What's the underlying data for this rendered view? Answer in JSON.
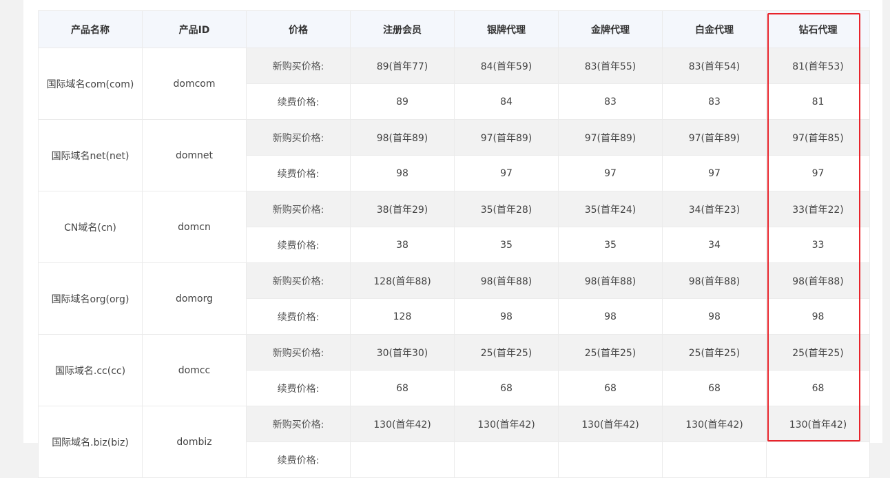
{
  "table": {
    "headers": [
      "产品名称",
      "产品ID",
      "价格",
      "注册会员",
      "银牌代理",
      "金牌代理",
      "白金代理",
      "钻石代理"
    ],
    "buy_label": "新购买价格:",
    "renew_label": "续费价格:",
    "products": [
      {
        "name": "国际域名com(com)",
        "id": "domcom",
        "buy": [
          "89(首年77)",
          "84(首年59)",
          "83(首年55)",
          "83(首年54)",
          "81(首年53)"
        ],
        "renew": [
          "89",
          "84",
          "83",
          "83",
          "81"
        ]
      },
      {
        "name": "国际域名net(net)",
        "id": "domnet",
        "buy": [
          "98(首年89)",
          "97(首年89)",
          "97(首年89)",
          "97(首年89)",
          "97(首年85)"
        ],
        "renew": [
          "98",
          "97",
          "97",
          "97",
          "97"
        ]
      },
      {
        "name": "CN域名(cn)",
        "id": "domcn",
        "buy": [
          "38(首年29)",
          "35(首年28)",
          "35(首年24)",
          "34(首年23)",
          "33(首年22)"
        ],
        "renew": [
          "38",
          "35",
          "35",
          "34",
          "33"
        ]
      },
      {
        "name": "国际域名org(org)",
        "id": "domorg",
        "buy": [
          "128(首年88)",
          "98(首年88)",
          "98(首年88)",
          "98(首年88)",
          "98(首年88)"
        ],
        "renew": [
          "128",
          "98",
          "98",
          "98",
          "98"
        ]
      },
      {
        "name": "国际域名.cc(cc)",
        "id": "domcc",
        "buy": [
          "30(首年30)",
          "25(首年25)",
          "25(首年25)",
          "25(首年25)",
          "25(首年25)"
        ],
        "renew": [
          "68",
          "68",
          "68",
          "68",
          "68"
        ]
      },
      {
        "name": "国际域名.biz(biz)",
        "id": "dombiz",
        "buy": [
          "130(首年42)",
          "130(首年42)",
          "130(首年42)",
          "130(首年42)",
          "130(首年42)"
        ],
        "renew": [
          "",
          "",
          "",
          "",
          ""
        ]
      }
    ]
  },
  "highlight": {
    "column": "钻石代理",
    "color": "#e8232b"
  }
}
